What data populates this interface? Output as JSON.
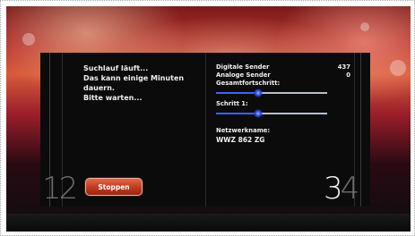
{
  "scan": {
    "message_lines": [
      "Suchlauf läuft...",
      "Das kann einige Minuten",
      "dauern.",
      "Bitte warten..."
    ],
    "stop_button_label": "Stoppen",
    "step_numbers": {
      "left_a": "1",
      "left_b": "2",
      "right_a": "3",
      "right_b": "4"
    }
  },
  "status": {
    "digital_label": "Digitale Sender",
    "digital_value": "437",
    "analog_label": "Analoge Sender",
    "analog_value": "0",
    "overall_label": "Gesamtfortschritt:",
    "overall_progress_percent": 38,
    "step_label": "Schritt 1:",
    "step_progress_percent": 38,
    "network_label": "Netzwerkname:",
    "network_value": "WWZ 862 ZG"
  },
  "colors": {
    "accent_blue": "#4060ff",
    "button_red": "#c0391f",
    "panel_bg": "#0b0b0c"
  }
}
